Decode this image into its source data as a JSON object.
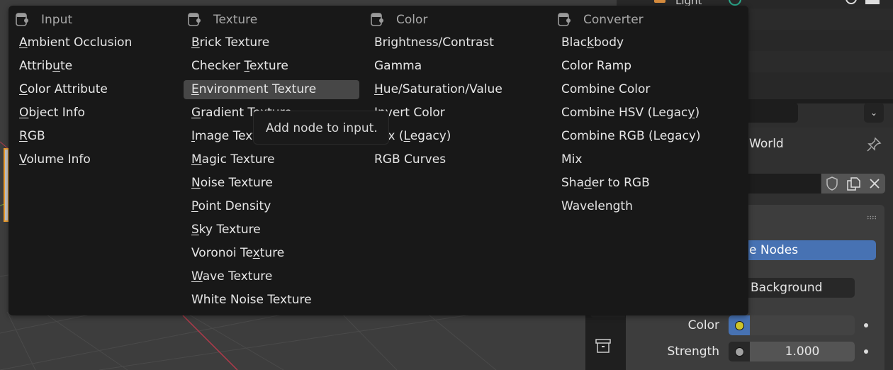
{
  "outliner": {
    "visible_text": "Light"
  },
  "add_menu": {
    "columns": [
      {
        "header": "Input",
        "icon": "node-socket-icon",
        "items": [
          {
            "label": "Ambient Occlusion",
            "underline": 0
          },
          {
            "label": "Attribute",
            "underline": 6
          },
          {
            "label": "Color Attribute",
            "underline": 0
          },
          {
            "label": "Object Info",
            "underline": 0
          },
          {
            "label": "RGB",
            "underline": 0
          },
          {
            "label": "Volume Info",
            "underline": 0
          }
        ]
      },
      {
        "header": "Texture",
        "icon": "node-socket-icon",
        "items": [
          {
            "label": "Brick Texture",
            "underline": 0
          },
          {
            "label": "Checker Texture",
            "underline": 8
          },
          {
            "label": "Environment Texture",
            "underline": 0,
            "highlighted": true
          },
          {
            "label": "Gradient Texture",
            "underline": 0
          },
          {
            "label": "Image Texture",
            "underline": 0
          },
          {
            "label": "Magic Texture",
            "underline": 0
          },
          {
            "label": "Noise Texture",
            "underline": 0
          },
          {
            "label": "Point Density",
            "underline": 0
          },
          {
            "label": "Sky Texture",
            "underline": 0
          },
          {
            "label": "Voronoi Texture",
            "underline": 10
          },
          {
            "label": "Wave Texture",
            "underline": 0
          },
          {
            "label": "White Noise Texture",
            "underline": -1
          }
        ]
      },
      {
        "header": "Color",
        "icon": "node-socket-icon",
        "items": [
          {
            "label": "Brightness/Contrast",
            "underline": -1
          },
          {
            "label": "Gamma",
            "underline": -1
          },
          {
            "label": "Hue/Saturation/Value",
            "underline": 0
          },
          {
            "label": "Invert Color",
            "underline": 0
          },
          {
            "label": "Mix (Legacy)",
            "underline": 5
          },
          {
            "label": "RGB Curves",
            "underline": -1
          }
        ]
      },
      {
        "header": "Converter",
        "icon": "node-socket-icon",
        "items": [
          {
            "label": "Blackbody",
            "underline": 4
          },
          {
            "label": "Color Ramp",
            "underline": -1
          },
          {
            "label": "Combine Color",
            "underline": -1
          },
          {
            "label": "Combine HSV (Legacy)",
            "underline": 18
          },
          {
            "label": "Combine RGB (Legacy)",
            "underline": -1
          },
          {
            "label": "Mix",
            "underline": -1
          },
          {
            "label": "Shader to RGB",
            "underline": 3
          },
          {
            "label": "Wavelength",
            "underline": -1
          }
        ]
      }
    ]
  },
  "tooltip": {
    "text": "Add node to input."
  },
  "properties": {
    "world_name": "World",
    "use_nodes_label": "e Nodes",
    "surface_value": "Background",
    "color_label": "Color",
    "strength_label": "Strength",
    "strength_value": "1.000",
    "color_socket": "#cdc42a",
    "strength_socket": "#a1a1a1",
    "accent": "#4772b3"
  }
}
